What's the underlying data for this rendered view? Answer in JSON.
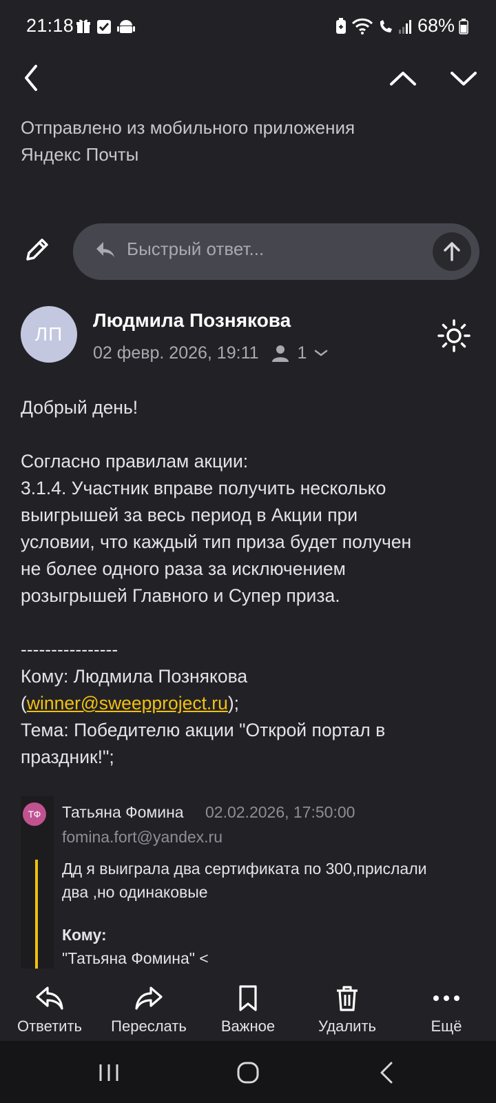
{
  "status_bar": {
    "time": "21:18",
    "left_icons": [
      "gift-icon",
      "checkbox-icon",
      "android-icon"
    ],
    "right_icons": [
      "battery-saver-icon",
      "wifi-icon",
      "wifi-call-icon",
      "signal-icon"
    ],
    "battery": "68%"
  },
  "nav": {
    "back_icon": "chevron-left-icon",
    "prev_icon": "chevron-up-icon",
    "next_icon": "chevron-down-icon"
  },
  "previous_message": {
    "signature_line1": "Отправлено из мобильного приложения",
    "signature_line2": "Яндекс Почты"
  },
  "quick_reply": {
    "placeholder": "Быстрый ответ..."
  },
  "message": {
    "avatar_initials": "ЛП",
    "sender": "Людмила Познякова",
    "date": "02 февр. 2026, 19:11",
    "recipients_count": "1",
    "body": {
      "greeting": "Добрый день!",
      "rules_intro": "Согласно правилам акции:",
      "rule_line1": "3.1.4. Участник вправе получить несколько",
      "rule_line2": "выигрышей за весь период в Акции при",
      "rule_line3": "условии, что каждый тип приза будет получен",
      "rule_line4": "не более одного раза за исключением",
      "rule_line5": "розыгрышей Главного и Супер приза.",
      "separator": "----------------",
      "to_line": "Кому: Людмила Познякова",
      "to_email_open": "(",
      "to_email": "winner@sweepproject.ru",
      "to_email_close": ");",
      "subject_line1": "Тема: Победителю акции \"Открой портал в",
      "subject_line2": "праздник!\";"
    },
    "quote": {
      "avatar_initials": "ТФ",
      "name": "Татьяна Фомина",
      "date": "02.02.2026, 17:50:00",
      "email": "fomina.fort@yandex.ru",
      "text_line1": "Дд  я выиграла два сертификата  по 300,прислали",
      "text_line2": "два ,но одинаковые",
      "to_label": "Кому:",
      "to_value": "\"Татьяна Фомина\" <"
    }
  },
  "actions": [
    {
      "label": "Ответить",
      "icon": "reply-icon"
    },
    {
      "label": "Переслать",
      "icon": "forward-icon"
    },
    {
      "label": "Важное",
      "icon": "bookmark-icon"
    },
    {
      "label": "Удалить",
      "icon": "trash-icon"
    },
    {
      "label": "Ещё",
      "icon": "more-icon"
    }
  ],
  "colors": {
    "background": "#222226",
    "accent": "#f3c10c",
    "avatar": "#c3c7e0",
    "quote_avatar": "#c0528f"
  }
}
